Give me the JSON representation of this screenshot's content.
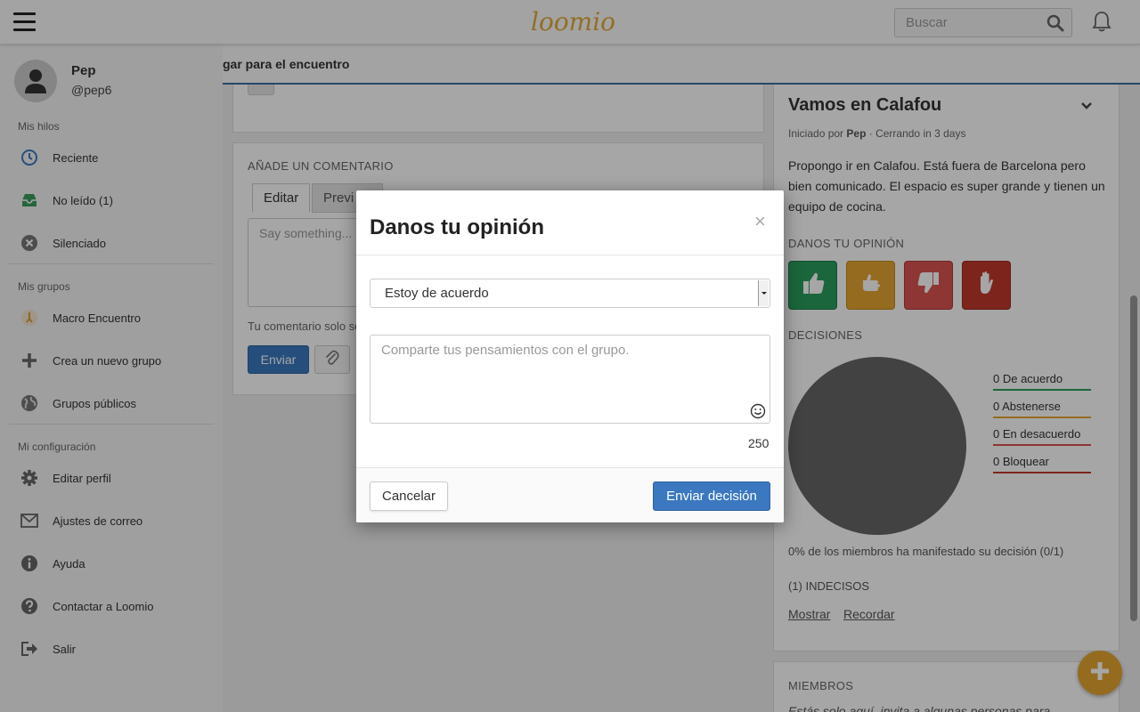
{
  "app": {
    "logo_text": "loomio",
    "brand_color": "#e2a93a",
    "accent_color": "#3b78c0"
  },
  "topbar": {
    "search_placeholder": "Buscar",
    "icons": [
      "menu-icon",
      "search-icon",
      "bell-icon"
    ]
  },
  "sidebar": {
    "user_name": "Pep",
    "user_handle": "@pep6",
    "threads_title": "Mis hilos",
    "thread_items": [
      {
        "label": "Reciente",
        "icon": "clock-icon"
      },
      {
        "label": "No leído (1)",
        "icon": "inbox-icon"
      },
      {
        "label": "Silenciado",
        "icon": "muted-icon"
      }
    ],
    "groups_title": "Mis grupos",
    "group_items": [
      {
        "label": "Macro Encuentro",
        "icon": "group-logo-icon"
      },
      {
        "label": "Crea un nuevo grupo",
        "icon": "plus-icon"
      },
      {
        "label": "Grupos públicos",
        "icon": "globe-icon"
      }
    ],
    "settings_title": "Mi configuración",
    "settings_items": [
      {
        "label": "Editar perfil",
        "icon": "gear-icon"
      },
      {
        "label": "Ajustes de correo",
        "icon": "envelope-icon"
      },
      {
        "label": "Ayuda",
        "icon": "info-icon"
      },
      {
        "label": "Contactar a Loomio",
        "icon": "help-icon"
      },
      {
        "label": "Salir",
        "icon": "logout-icon"
      }
    ]
  },
  "context_bar": {
    "title": "gar para el encuentro"
  },
  "comment": {
    "title": "AÑADE UN COMENTARIO",
    "tab_edit": "Editar",
    "tab_preview": "Previ",
    "placeholder": "Say something...",
    "note": "Tu comentario solo se",
    "send_label": "Enviar"
  },
  "proposal": {
    "title": "Vamos en Calafou",
    "started_by_label": "Iniciado por",
    "author": "Pep",
    "closing": "· Cerrando in 3 days",
    "description": "Propongo ir en Calafou. Está fuera de Barcelona pero bien comunicado. El espacio es super grande y tienen un equipo de cocina.",
    "vote_title": "DANOS TU OPINIÓN",
    "vote_buttons": [
      {
        "name": "agree",
        "color": "#2a9d5c"
      },
      {
        "name": "abstain",
        "color": "#e5a730"
      },
      {
        "name": "disagree",
        "color": "#d9534f"
      },
      {
        "name": "block",
        "color": "#c0392b"
      }
    ],
    "decisions_title": "DECISIONES",
    "legend": [
      {
        "label": "0 De acuerdo",
        "color": "#2a9d5c"
      },
      {
        "label": "0 Abstenerse",
        "color": "#e5a730"
      },
      {
        "label": "0 En desacuerdo",
        "color": "#d9534f"
      },
      {
        "label": "0 Bloquear",
        "color": "#c0392b"
      }
    ],
    "stat": "0% de los miembros ha manifestado su decisión (0/1)",
    "undecided": "(1) INDECISOS",
    "link_show": "Mostrar",
    "link_remind": "Recordar"
  },
  "members": {
    "title": "MIEMBROS",
    "text": "Estás solo aquí, invita a algunas personas para"
  },
  "modal": {
    "title": "Danos tu opinión",
    "close": "×",
    "select_value": "Estoy de acuerdo",
    "textarea_placeholder": "Comparte tus pensamientos con el grupo.",
    "char_count": "250",
    "cancel_label": "Cancelar",
    "submit_label": "Enviar decisión"
  }
}
